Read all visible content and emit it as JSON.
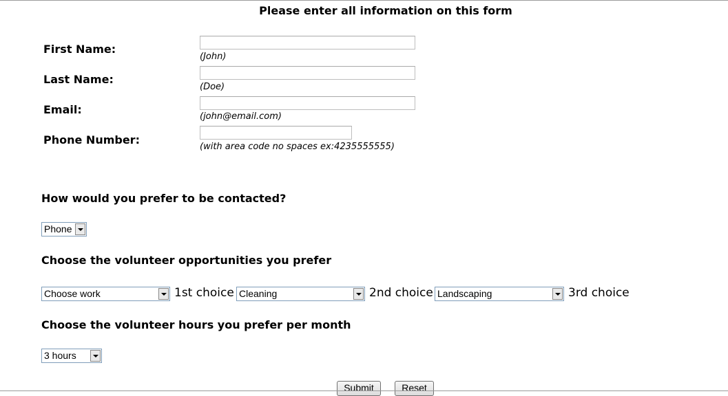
{
  "form": {
    "title": "Please enter all information on this form",
    "fields": [
      {
        "label": "First Name:",
        "hint": "(John)",
        "value": ""
      },
      {
        "label": "Last Name:",
        "hint": "(Doe)",
        "value": ""
      },
      {
        "label": "Email:",
        "hint": "(john@email.com)",
        "value": ""
      },
      {
        "label": "Phone Number:",
        "hint": "(with area code no spaces ex:4235555555)",
        "value": ""
      }
    ],
    "contact": {
      "question": "How would you prefer to be contacted?",
      "selected": "Phone"
    },
    "opportunities": {
      "question": "Choose the volunteer opportunities you prefer",
      "selects": [
        {
          "selected": "Choose work",
          "label": "1st choice"
        },
        {
          "selected": "Cleaning",
          "label": "2nd choice"
        },
        {
          "selected": "Landscaping",
          "label": "3rd choice"
        }
      ]
    },
    "hours": {
      "question": "Choose the volunteer hours you prefer per month",
      "selected": "3 hours"
    },
    "buttons": {
      "submit": "Submit",
      "reset": "Reset"
    }
  }
}
